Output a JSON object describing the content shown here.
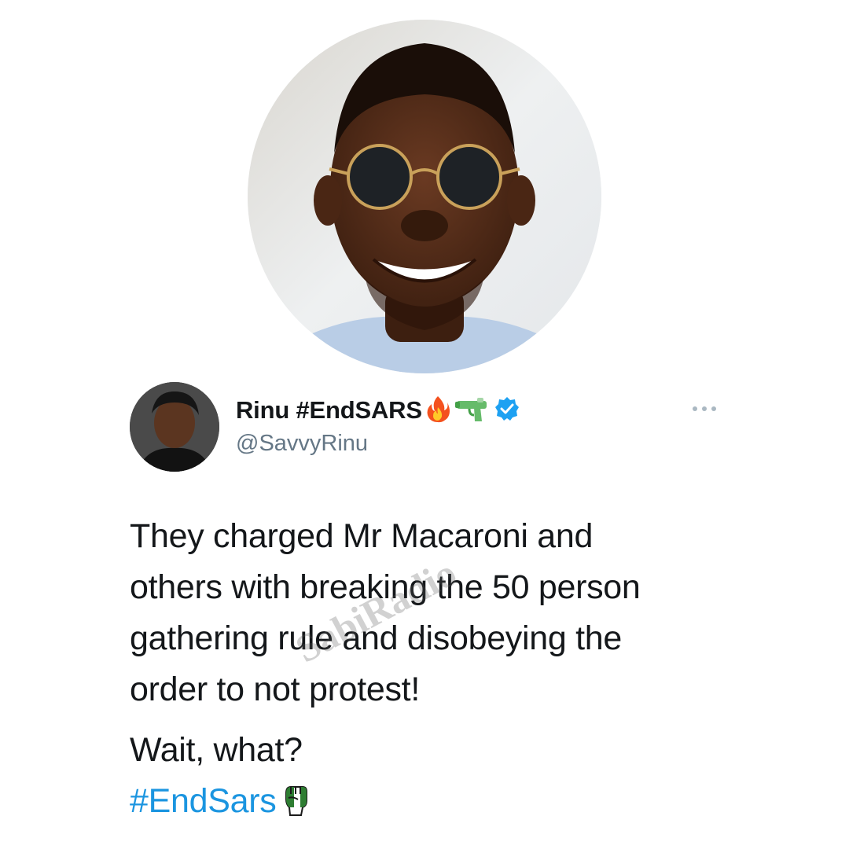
{
  "hero": {
    "alt_subject": "profile photo"
  },
  "author": {
    "name": "Rinu #EndSARS",
    "handle": "@SavvyRinu",
    "name_emojis": [
      "fire-emoji",
      "water-pistol-emoji"
    ],
    "verified": true
  },
  "tweet": {
    "lines": [
      "They charged Mr Macaroni and",
      "others with breaking the 50 person",
      "gathering rule and disobeying the",
      "order to not protest!"
    ],
    "line_2": "Wait, what?",
    "hashtag": "#EndSars",
    "hashtag_emoji": "raised-fist-emoji"
  },
  "watermark": {
    "text": "SabiRadio"
  },
  "colors": {
    "text_primary": "#14171a",
    "text_secondary": "#657786",
    "link": "#1b95e0",
    "verified": "#1da1f2",
    "background": "#ffffff"
  }
}
